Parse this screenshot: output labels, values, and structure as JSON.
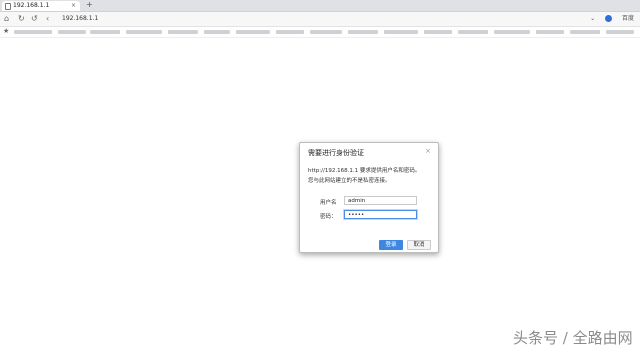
{
  "tab": {
    "title": "192.168.1.1",
    "close": "×",
    "new_tab": "+"
  },
  "toolbar": {
    "url": "192.168.1.1",
    "search_engine_label": "百度",
    "icons": [
      "home-icon",
      "reload-icon",
      "undo-icon",
      "back-icon",
      "search-engine-icon"
    ]
  },
  "bookmarks": {
    "star_icon": "★"
  },
  "dialog": {
    "title": "需要进行身份验证",
    "close": "×",
    "message_line1": "http://192.168.1.1 要求提供用户名和密码。",
    "message_line2": "您与此网站建立的不是私密连接。",
    "username_label": "用户名",
    "username_value": "admin",
    "password_label": "密码：",
    "password_value": "•••••",
    "login_button": "登录",
    "cancel_button": "取消",
    "accent_color": "#3d87e2"
  },
  "watermark": {
    "text": "头条号 / 全路由网"
  }
}
